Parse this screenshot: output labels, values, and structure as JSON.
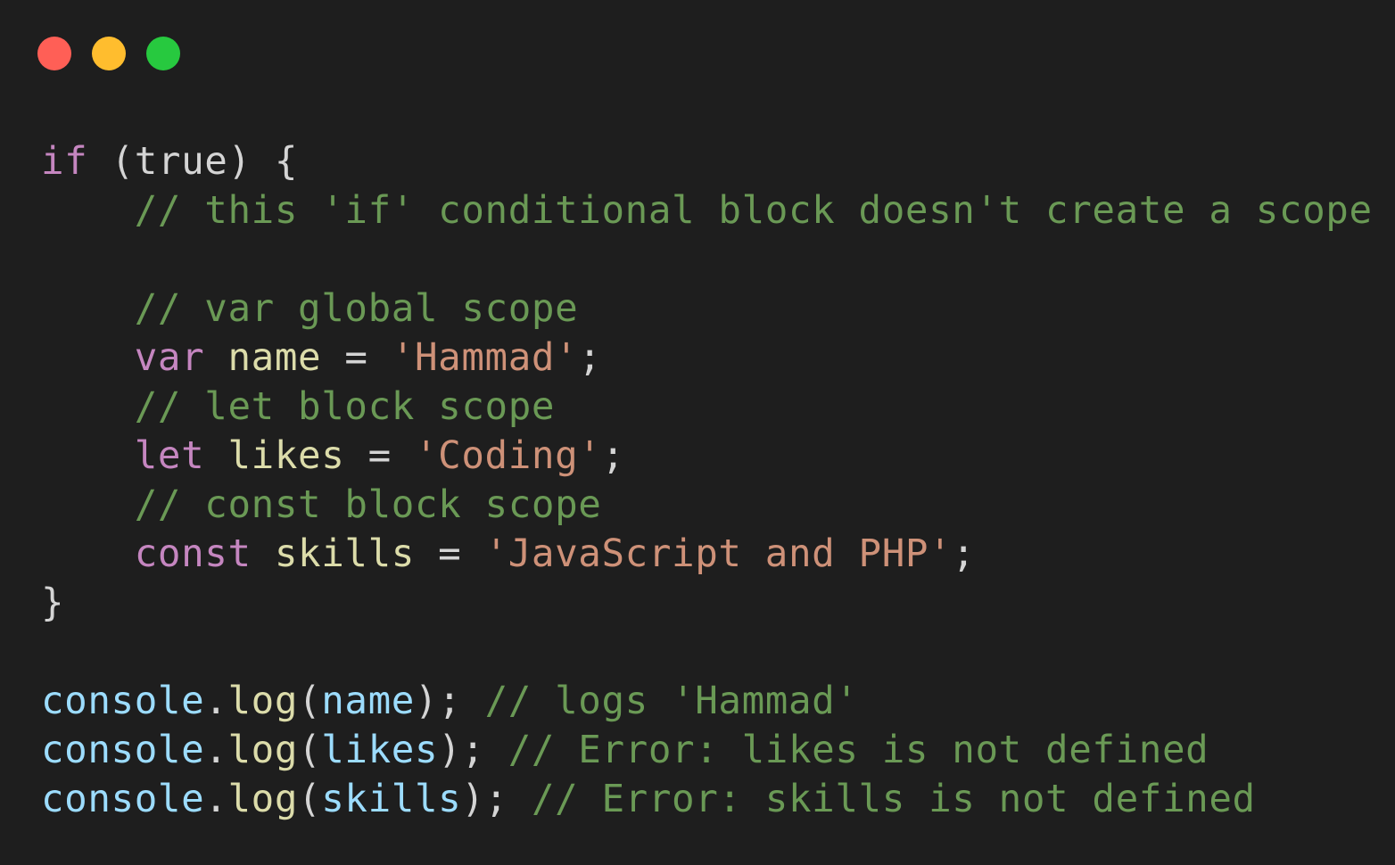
{
  "window": {
    "controls": [
      {
        "name": "close",
        "color": "#ff5f56"
      },
      {
        "name": "minimize",
        "color": "#ffbd2e"
      },
      {
        "name": "maximize",
        "color": "#27c93f"
      }
    ]
  },
  "code": {
    "lines": [
      [
        {
          "t": "if",
          "c": "keyword"
        },
        {
          "t": " (true) {",
          "c": "plain"
        }
      ],
      [
        {
          "t": "    // this 'if' conditional block doesn't create a scope",
          "c": "comment"
        }
      ],
      [],
      [
        {
          "t": "    // var global scope",
          "c": "comment"
        }
      ],
      [
        {
          "t": "    ",
          "c": "plain"
        },
        {
          "t": "var",
          "c": "decl"
        },
        {
          "t": " ",
          "c": "plain"
        },
        {
          "t": "name",
          "c": "ident"
        },
        {
          "t": " = ",
          "c": "plain"
        },
        {
          "t": "'Hammad'",
          "c": "string"
        },
        {
          "t": ";",
          "c": "punct"
        }
      ],
      [
        {
          "t": "    // let block scope",
          "c": "comment"
        }
      ],
      [
        {
          "t": "    ",
          "c": "plain"
        },
        {
          "t": "let",
          "c": "decl"
        },
        {
          "t": " ",
          "c": "plain"
        },
        {
          "t": "likes",
          "c": "ident"
        },
        {
          "t": " = ",
          "c": "plain"
        },
        {
          "t": "'Coding'",
          "c": "string"
        },
        {
          "t": ";",
          "c": "punct"
        }
      ],
      [
        {
          "t": "    // const block scope",
          "c": "comment"
        }
      ],
      [
        {
          "t": "    ",
          "c": "plain"
        },
        {
          "t": "const",
          "c": "decl"
        },
        {
          "t": " ",
          "c": "plain"
        },
        {
          "t": "skills",
          "c": "ident"
        },
        {
          "t": " = ",
          "c": "plain"
        },
        {
          "t": "'JavaScript and PHP'",
          "c": "string"
        },
        {
          "t": ";",
          "c": "punct"
        }
      ],
      [
        {
          "t": "}",
          "c": "plain"
        }
      ],
      [],
      [
        {
          "t": "console",
          "c": "obj"
        },
        {
          "t": ".",
          "c": "punct"
        },
        {
          "t": "log",
          "c": "method"
        },
        {
          "t": "(",
          "c": "punct"
        },
        {
          "t": "name",
          "c": "arg"
        },
        {
          "t": "); ",
          "c": "punct"
        },
        {
          "t": "// logs 'Hammad'",
          "c": "comment"
        }
      ],
      [
        {
          "t": "console",
          "c": "obj"
        },
        {
          "t": ".",
          "c": "punct"
        },
        {
          "t": "log",
          "c": "method"
        },
        {
          "t": "(",
          "c": "punct"
        },
        {
          "t": "likes",
          "c": "arg"
        },
        {
          "t": "); ",
          "c": "punct"
        },
        {
          "t": "// Error: likes is not defined",
          "c": "comment"
        }
      ],
      [
        {
          "t": "console",
          "c": "obj"
        },
        {
          "t": ".",
          "c": "punct"
        },
        {
          "t": "log",
          "c": "method"
        },
        {
          "t": "(",
          "c": "punct"
        },
        {
          "t": "skills",
          "c": "arg"
        },
        {
          "t": "); ",
          "c": "punct"
        },
        {
          "t": "// Error: skills is not defined",
          "c": "comment"
        }
      ]
    ]
  }
}
